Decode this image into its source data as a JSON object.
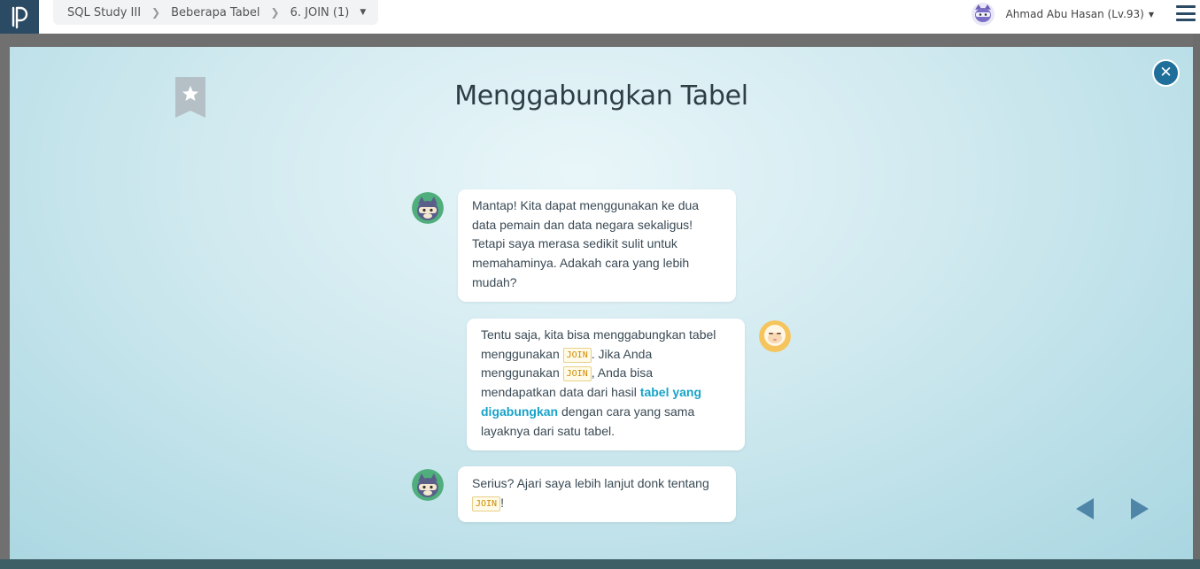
{
  "topbar": {
    "breadcrumbs": [
      "SQL Study III",
      "Beberapa Tabel",
      "6. JOIN (1)"
    ],
    "user_name": "Ahmad Abu Hasan (Lv.93)"
  },
  "modal": {
    "title": "Menggabungkan Tabel",
    "messages": [
      {
        "speaker": "ninja-cat",
        "text": "Mantap! Kita dapat menggunakan ke dua data pemain dan data negara sekaligus! Tetapi saya merasa sedikit sulit untuk memahaminya. Adakah cara yang lebih mudah?"
      },
      {
        "speaker": "sheep",
        "parts": {
          "p1": "Tentu saja, kita bisa menggabungkan tabel menggunakan ",
          "code1": "JOIN",
          "p2": ". Jika Anda menggunakan ",
          "code2": "JOIN",
          "p3": ", Anda bisa mendapatkan data dari hasil ",
          "highlight": "tabel yang digabungkan",
          "p4": " dengan cara yang sama layaknya dari satu tabel."
        }
      },
      {
        "speaker": "ninja-cat",
        "parts": {
          "p1": "Serius? Ajari saya lebih lanjut donk tentang ",
          "code1": "JOIN",
          "p2": "!"
        }
      }
    ]
  },
  "icons": {
    "logo": "logo-icon",
    "bookmark": "bookmark-star-icon",
    "close": "close-icon",
    "prev": "prev-arrow-icon",
    "next": "next-arrow-icon",
    "menu": "hamburger-menu-icon"
  },
  "colors": {
    "accent": "#17a3c9",
    "brand_dark": "#2b4a63",
    "close_button": "#1f6f9a",
    "arrow": "#4f86a8",
    "code_text": "#d08b00"
  }
}
